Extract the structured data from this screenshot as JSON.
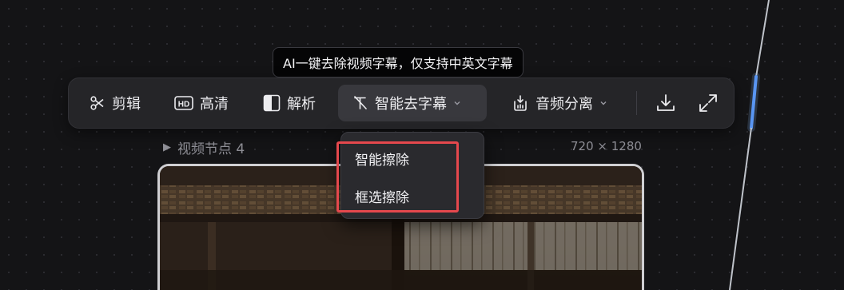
{
  "tooltip": {
    "text": "AI一键去除视频字幕，仅支持中英文字幕"
  },
  "toolbar": {
    "items": [
      {
        "label": "剪辑",
        "icon": "scissors-icon"
      },
      {
        "label": "高清",
        "icon": "hd-icon"
      },
      {
        "label": "解析",
        "icon": "split-square-icon"
      },
      {
        "label": "智能去字幕",
        "icon": "remove-text-icon",
        "active": true,
        "has_dropdown": true
      },
      {
        "label": "音频分离",
        "icon": "audio-split-icon",
        "has_dropdown": true
      }
    ],
    "download_icon": "download-icon",
    "fullscreen_icon": "expand-icon"
  },
  "node": {
    "title": "视频节点 4",
    "resolution": "720 × 1280"
  },
  "dropdown": {
    "options": [
      "智能擦除",
      "框选擦除"
    ]
  },
  "colors": {
    "background": "#141416",
    "toolbar": "#252528",
    "highlight": "#e5484d",
    "connector": "#6aa8ff"
  }
}
